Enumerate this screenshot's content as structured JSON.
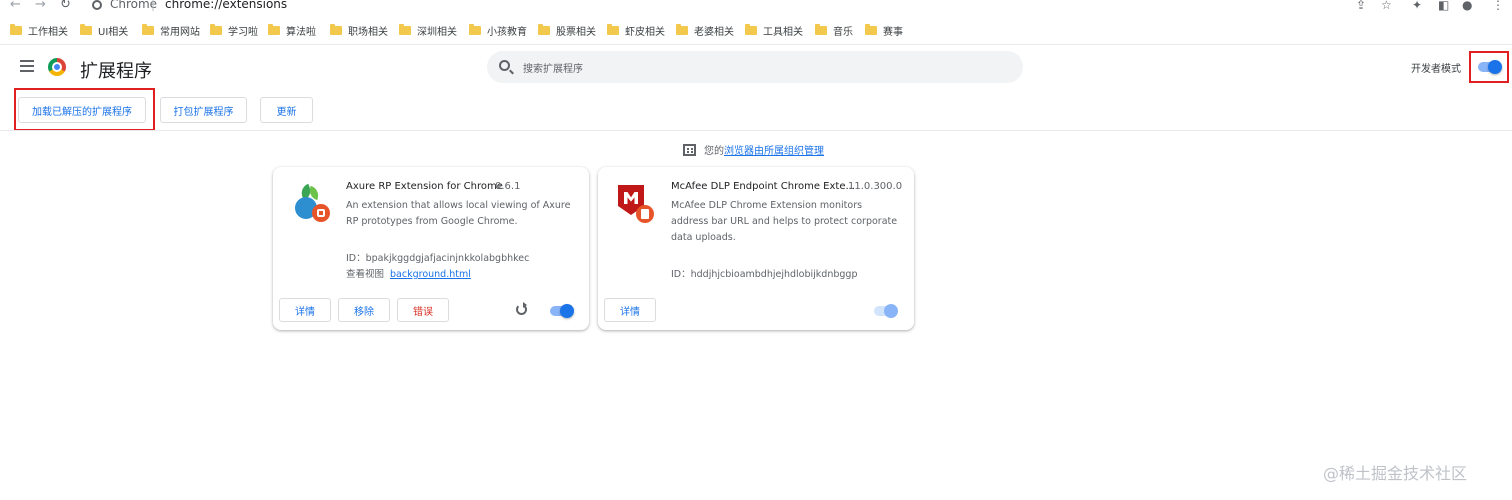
{
  "address_bar": {
    "site_name": "Chrome",
    "separator": "|",
    "url": "chrome://extensions"
  },
  "bookmarks": [
    {
      "label": "工作相关"
    },
    {
      "label": "UI相关"
    },
    {
      "label": "常用网站"
    },
    {
      "label": "学习啦"
    },
    {
      "label": "算法啦"
    },
    {
      "label": "职场相关"
    },
    {
      "label": "深圳相关"
    },
    {
      "label": "小孩教育"
    },
    {
      "label": "股票相关"
    },
    {
      "label": "虾皮相关"
    },
    {
      "label": "老婆相关"
    },
    {
      "label": "工具相关"
    },
    {
      "label": "音乐"
    },
    {
      "label": "赛事"
    }
  ],
  "header": {
    "title": "扩展程序",
    "search_placeholder": "搜索扩展程序",
    "dev_mode_label": "开发者模式",
    "dev_mode_on": true
  },
  "toolbar": {
    "load_unpacked": "加载已解压的扩展程序",
    "pack": "打包扩展程序",
    "update": "更新"
  },
  "managed": {
    "prefix": "您的",
    "link": "浏览器由所属组织管理"
  },
  "extensions": [
    {
      "name": "Axure RP Extension for Chrome",
      "version": "0.6.1",
      "description": "An extension that allows local viewing of Axure RP prototypes from Google Chrome.",
      "id_text": "ID：bpakjkggdgjafjacinjnkkolabgbhkec",
      "views_label": "查看视图",
      "views_link": "background.html",
      "details": "详情",
      "remove": "移除",
      "errors": "错误",
      "enabled": true,
      "icon": "axure-icon"
    },
    {
      "name": "McAfee DLP Endpoint Chrome Exte...",
      "version": "11.0.300.0",
      "description": "McAfee DLP Chrome Extension monitors address bar URL and helps to protect corporate data uploads.",
      "id_text": "ID：hddjhjcbioambdhjejhdlobijkdnbggp",
      "details": "详情",
      "enabled": true,
      "policy_locked": true,
      "icon": "mcafee-icon"
    }
  ],
  "watermark": "@稀土掘金技术社区",
  "colors": {
    "accent": "#1a73e8",
    "error": "#d93025",
    "highlight_box": "#e02020"
  }
}
